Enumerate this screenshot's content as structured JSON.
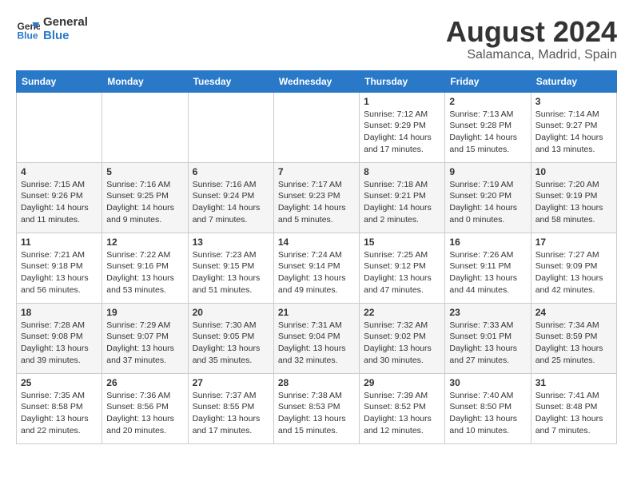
{
  "header": {
    "logo_text_general": "General",
    "logo_text_blue": "Blue",
    "month": "August 2024",
    "location": "Salamanca, Madrid, Spain"
  },
  "weekdays": [
    "Sunday",
    "Monday",
    "Tuesday",
    "Wednesday",
    "Thursday",
    "Friday",
    "Saturday"
  ],
  "weeks": [
    [
      {
        "day": "",
        "info": ""
      },
      {
        "day": "",
        "info": ""
      },
      {
        "day": "",
        "info": ""
      },
      {
        "day": "",
        "info": ""
      },
      {
        "day": "1",
        "info": "Sunrise: 7:12 AM\nSunset: 9:29 PM\nDaylight: 14 hours\nand 17 minutes."
      },
      {
        "day": "2",
        "info": "Sunrise: 7:13 AM\nSunset: 9:28 PM\nDaylight: 14 hours\nand 15 minutes."
      },
      {
        "day": "3",
        "info": "Sunrise: 7:14 AM\nSunset: 9:27 PM\nDaylight: 14 hours\nand 13 minutes."
      }
    ],
    [
      {
        "day": "4",
        "info": "Sunrise: 7:15 AM\nSunset: 9:26 PM\nDaylight: 14 hours\nand 11 minutes."
      },
      {
        "day": "5",
        "info": "Sunrise: 7:16 AM\nSunset: 9:25 PM\nDaylight: 14 hours\nand 9 minutes."
      },
      {
        "day": "6",
        "info": "Sunrise: 7:16 AM\nSunset: 9:24 PM\nDaylight: 14 hours\nand 7 minutes."
      },
      {
        "day": "7",
        "info": "Sunrise: 7:17 AM\nSunset: 9:23 PM\nDaylight: 14 hours\nand 5 minutes."
      },
      {
        "day": "8",
        "info": "Sunrise: 7:18 AM\nSunset: 9:21 PM\nDaylight: 14 hours\nand 2 minutes."
      },
      {
        "day": "9",
        "info": "Sunrise: 7:19 AM\nSunset: 9:20 PM\nDaylight: 14 hours\nand 0 minutes."
      },
      {
        "day": "10",
        "info": "Sunrise: 7:20 AM\nSunset: 9:19 PM\nDaylight: 13 hours\nand 58 minutes."
      }
    ],
    [
      {
        "day": "11",
        "info": "Sunrise: 7:21 AM\nSunset: 9:18 PM\nDaylight: 13 hours\nand 56 minutes."
      },
      {
        "day": "12",
        "info": "Sunrise: 7:22 AM\nSunset: 9:16 PM\nDaylight: 13 hours\nand 53 minutes."
      },
      {
        "day": "13",
        "info": "Sunrise: 7:23 AM\nSunset: 9:15 PM\nDaylight: 13 hours\nand 51 minutes."
      },
      {
        "day": "14",
        "info": "Sunrise: 7:24 AM\nSunset: 9:14 PM\nDaylight: 13 hours\nand 49 minutes."
      },
      {
        "day": "15",
        "info": "Sunrise: 7:25 AM\nSunset: 9:12 PM\nDaylight: 13 hours\nand 47 minutes."
      },
      {
        "day": "16",
        "info": "Sunrise: 7:26 AM\nSunset: 9:11 PM\nDaylight: 13 hours\nand 44 minutes."
      },
      {
        "day": "17",
        "info": "Sunrise: 7:27 AM\nSunset: 9:09 PM\nDaylight: 13 hours\nand 42 minutes."
      }
    ],
    [
      {
        "day": "18",
        "info": "Sunrise: 7:28 AM\nSunset: 9:08 PM\nDaylight: 13 hours\nand 39 minutes."
      },
      {
        "day": "19",
        "info": "Sunrise: 7:29 AM\nSunset: 9:07 PM\nDaylight: 13 hours\nand 37 minutes."
      },
      {
        "day": "20",
        "info": "Sunrise: 7:30 AM\nSunset: 9:05 PM\nDaylight: 13 hours\nand 35 minutes."
      },
      {
        "day": "21",
        "info": "Sunrise: 7:31 AM\nSunset: 9:04 PM\nDaylight: 13 hours\nand 32 minutes."
      },
      {
        "day": "22",
        "info": "Sunrise: 7:32 AM\nSunset: 9:02 PM\nDaylight: 13 hours\nand 30 minutes."
      },
      {
        "day": "23",
        "info": "Sunrise: 7:33 AM\nSunset: 9:01 PM\nDaylight: 13 hours\nand 27 minutes."
      },
      {
        "day": "24",
        "info": "Sunrise: 7:34 AM\nSunset: 8:59 PM\nDaylight: 13 hours\nand 25 minutes."
      }
    ],
    [
      {
        "day": "25",
        "info": "Sunrise: 7:35 AM\nSunset: 8:58 PM\nDaylight: 13 hours\nand 22 minutes."
      },
      {
        "day": "26",
        "info": "Sunrise: 7:36 AM\nSunset: 8:56 PM\nDaylight: 13 hours\nand 20 minutes."
      },
      {
        "day": "27",
        "info": "Sunrise: 7:37 AM\nSunset: 8:55 PM\nDaylight: 13 hours\nand 17 minutes."
      },
      {
        "day": "28",
        "info": "Sunrise: 7:38 AM\nSunset: 8:53 PM\nDaylight: 13 hours\nand 15 minutes."
      },
      {
        "day": "29",
        "info": "Sunrise: 7:39 AM\nSunset: 8:52 PM\nDaylight: 13 hours\nand 12 minutes."
      },
      {
        "day": "30",
        "info": "Sunrise: 7:40 AM\nSunset: 8:50 PM\nDaylight: 13 hours\nand 10 minutes."
      },
      {
        "day": "31",
        "info": "Sunrise: 7:41 AM\nSunset: 8:48 PM\nDaylight: 13 hours\nand 7 minutes."
      }
    ]
  ]
}
